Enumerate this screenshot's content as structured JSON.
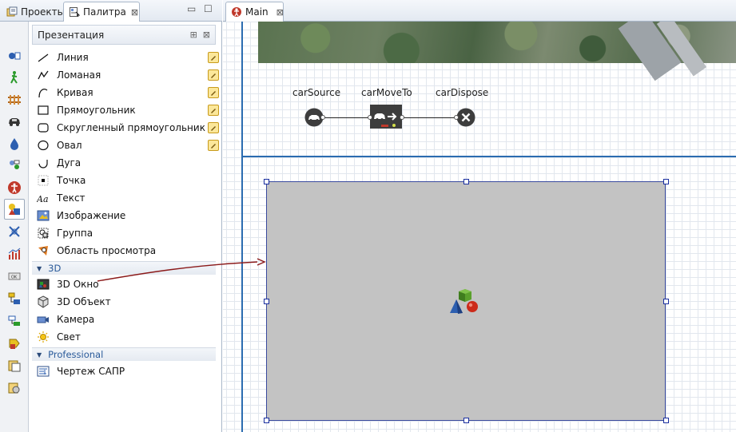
{
  "left_tabs": {
    "projects_label": "Проекты",
    "palette_label": "Палитра",
    "close_glyph": "⊠"
  },
  "palette": {
    "section_title": "Презентация",
    "presentation_items": [
      {
        "label": "Линия",
        "icon": "line-icon",
        "editable": true
      },
      {
        "label": "Ломаная",
        "icon": "polyline-icon",
        "editable": true
      },
      {
        "label": "Кривая",
        "icon": "curve-icon",
        "editable": true
      },
      {
        "label": "Прямоугольник",
        "icon": "rectangle-icon",
        "editable": true
      },
      {
        "label": "Скругленный прямоугольник",
        "icon": "rounded-rectangle-icon",
        "editable": true
      },
      {
        "label": "Овал",
        "icon": "oval-icon",
        "editable": true
      },
      {
        "label": "Дуга",
        "icon": "arc-icon",
        "editable": false
      },
      {
        "label": "Точка",
        "icon": "point-icon",
        "editable": false
      },
      {
        "label": "Текст",
        "icon": "text-icon",
        "editable": false
      },
      {
        "label": "Изображение",
        "icon": "image-icon",
        "editable": false
      },
      {
        "label": "Группа",
        "icon": "group-icon",
        "editable": false
      },
      {
        "label": "Область просмотра",
        "icon": "view-area-icon",
        "editable": false
      }
    ],
    "group_3d_title": "3D",
    "items_3d": [
      {
        "label": "3D Окно",
        "icon": "window-3d-icon"
      },
      {
        "label": "3D Объект",
        "icon": "object-3d-icon"
      },
      {
        "label": "Камера",
        "icon": "camera-icon"
      },
      {
        "label": "Свет",
        "icon": "light-icon"
      }
    ],
    "group_professional_title": "Professional",
    "items_professional": [
      {
        "label": "Чертеж САПР",
        "icon": "cad-drawing-icon"
      }
    ]
  },
  "icon_strip": [
    "process-modeling-icon",
    "pedestrian-icon",
    "rail-icon",
    "road-traffic-icon",
    "fluid-icon",
    "agent-icon",
    "accessibility-icon",
    "presentation-icon",
    "space-markup-icon",
    "analysis-icon",
    "controls-icon",
    "connectivity-icon",
    "system-dynamics-icon",
    "actionchart-icon",
    "pictures-icon",
    "3d-objects-icon"
  ],
  "editor": {
    "tab_label": "Main"
  },
  "flowchart": {
    "blocks": [
      {
        "name": "carSource"
      },
      {
        "name": "carMoveTo"
      },
      {
        "name": "carDispose"
      }
    ]
  },
  "colors": {
    "selection": "#1a2fa0",
    "frame_line": "#2b6cb0",
    "view3d_fill": "#c3c3c3",
    "link_arrow": "#8b1a1a"
  }
}
